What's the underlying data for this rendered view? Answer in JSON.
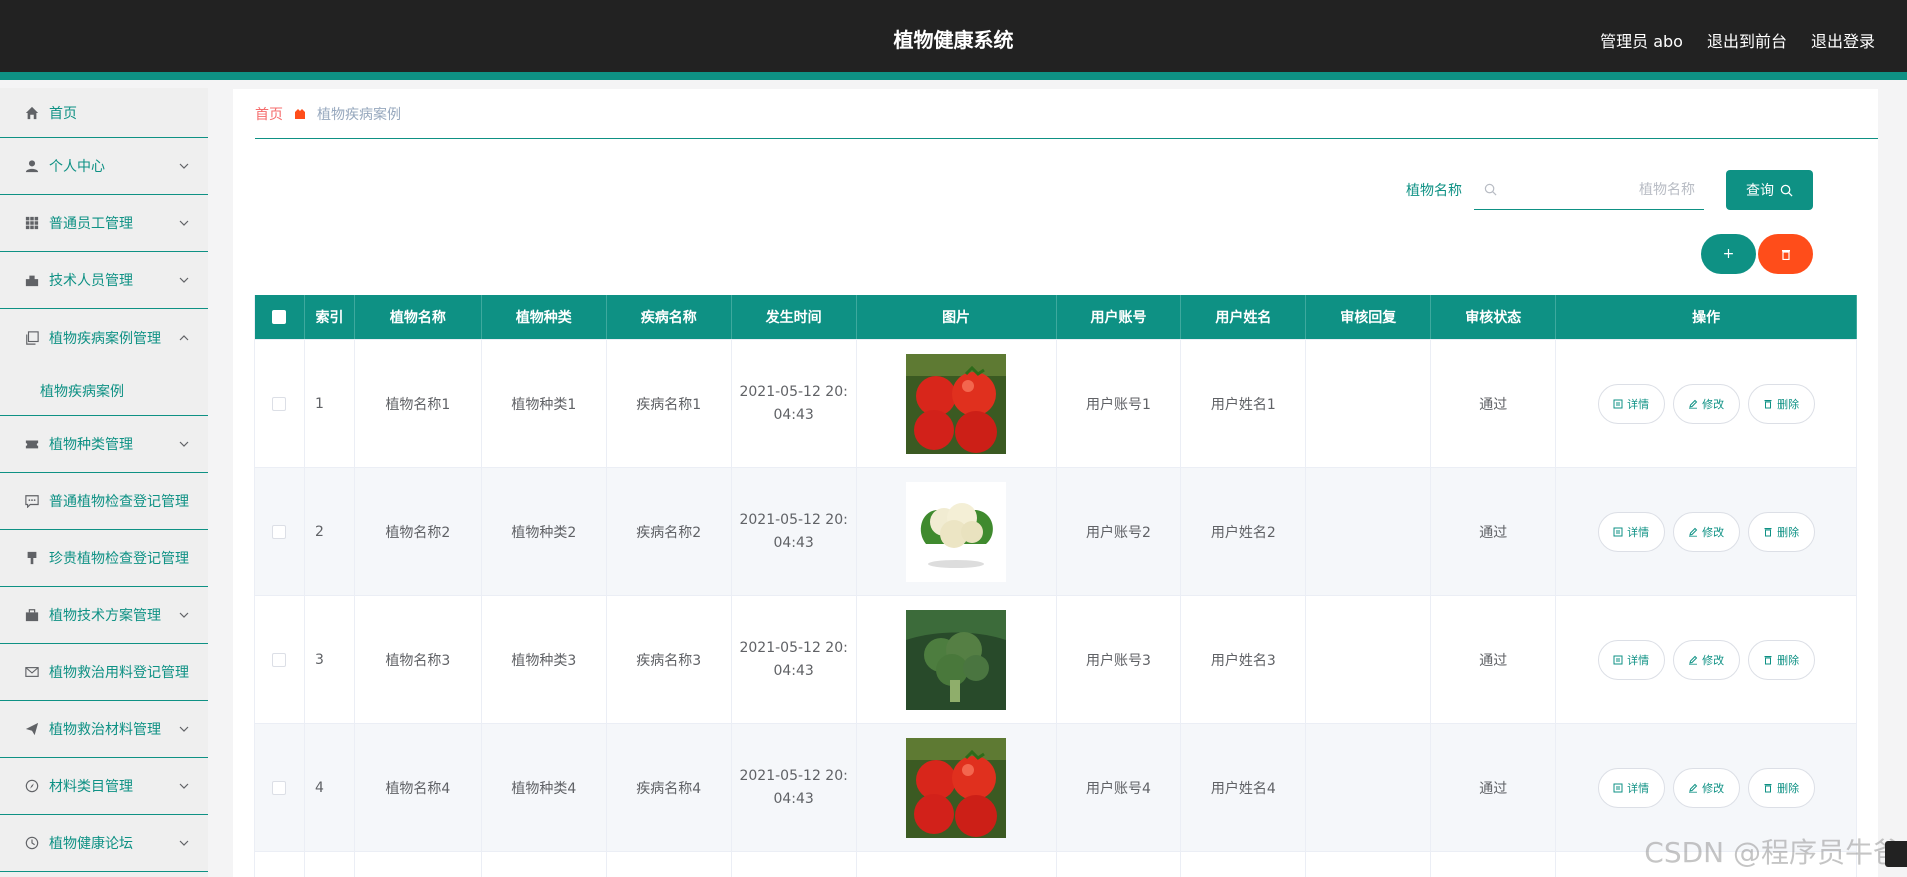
{
  "header": {
    "title": "植物健康系统",
    "admin_label": "管理员 abo",
    "back_frontend": "退出到前台",
    "logout": "退出登录"
  },
  "sidebar": {
    "items": [
      {
        "label": "首页",
        "icon": "home-icon",
        "expandable": false
      },
      {
        "label": "个人中心",
        "icon": "user-icon",
        "expandable": true
      },
      {
        "label": "普通员工管理",
        "icon": "grid-icon",
        "expandable": true
      },
      {
        "label": "技术人员管理",
        "icon": "briefcase-icon",
        "expandable": true
      },
      {
        "label": "植物疾病案例管理",
        "icon": "copy-icon",
        "expandable": true,
        "expanded": true
      },
      {
        "label": "植物种类管理",
        "icon": "ticket-icon",
        "expandable": true
      },
      {
        "label": "普通植物检查登记管理",
        "icon": "chat-icon",
        "expandable": false
      },
      {
        "label": "珍贵植物检查登记管理",
        "icon": "brush-icon",
        "expandable": false
      },
      {
        "label": "植物技术方案管理",
        "icon": "suitcase-icon",
        "expandable": true
      },
      {
        "label": "植物救治用料登记管理",
        "icon": "mail-icon",
        "expandable": false
      },
      {
        "label": "植物救治材料管理",
        "icon": "send-icon",
        "expandable": true
      },
      {
        "label": "材料类目管理",
        "icon": "compass-icon",
        "expandable": true
      },
      {
        "label": "植物健康论坛",
        "icon": "clock-icon",
        "expandable": true
      }
    ],
    "submenu_label": "植物疾病案例"
  },
  "breadcrumb": {
    "home": "首页",
    "current": "植物疾病案例"
  },
  "search": {
    "label": "植物名称",
    "placeholder": "植物名称",
    "value": "",
    "button": "查询"
  },
  "actions": {
    "add": "+",
    "delete_icon": "trash-icon"
  },
  "table": {
    "headers": [
      "索引",
      "植物名称",
      "植物种类",
      "疾病名称",
      "发生时间",
      "图片",
      "用户账号",
      "用户姓名",
      "审核回复",
      "审核状态",
      "操作"
    ],
    "ops": {
      "detail": "详情",
      "edit": "修改",
      "delete": "删除"
    },
    "rows": [
      {
        "index": "1",
        "plant": "植物名称1",
        "kind": "植物种类1",
        "disease": "疾病名称1",
        "time": "2021-05-12 20:04:43",
        "image": "tomato",
        "account": "用户账号1",
        "name": "用户姓名1",
        "reply": "",
        "status": "通过"
      },
      {
        "index": "2",
        "plant": "植物名称2",
        "kind": "植物种类2",
        "disease": "疾病名称2",
        "time": "2021-05-12 20:04:43",
        "image": "cauliflower",
        "account": "用户账号2",
        "name": "用户姓名2",
        "reply": "",
        "status": "通过"
      },
      {
        "index": "3",
        "plant": "植物名称3",
        "kind": "植物种类3",
        "disease": "疾病名称3",
        "time": "2021-05-12 20:04:43",
        "image": "broccoli",
        "account": "用户账号3",
        "name": "用户姓名3",
        "reply": "",
        "status": "通过"
      },
      {
        "index": "4",
        "plant": "植物名称4",
        "kind": "植物种类4",
        "disease": "疾病名称4",
        "time": "2021-05-12 20:04:43",
        "image": "tomato",
        "account": "用户账号4",
        "name": "用户姓名4",
        "reply": "",
        "status": "通过"
      }
    ]
  },
  "watermark": "CSDN @程序员牛爸",
  "colors": {
    "primary": "#0e9184",
    "danger": "#ff4d1a",
    "header_bg": "#222222",
    "sidebar_bg": "#efefef"
  }
}
